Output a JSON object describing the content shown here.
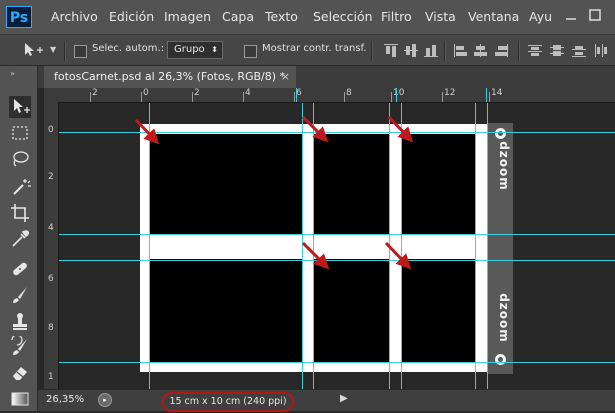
{
  "app": {
    "logo": "Ps"
  },
  "menu": [
    "Archivo",
    "Edición",
    "Imagen",
    "Capa",
    "Texto",
    "Selección",
    "Filtro",
    "Vista",
    "Ventana",
    "Ayu"
  ],
  "options": {
    "auto_select_label": "Selec. autom.:",
    "auto_select_value": "Grupo",
    "transform_label": "Mostrar contr. transf."
  },
  "tools": [
    "move-tool",
    "marquee-tool",
    "lasso-tool",
    "magic-wand-tool",
    "crop-tool",
    "eyedropper-tool",
    "healing-brush-tool",
    "brush-tool",
    "clone-stamp-tool",
    "history-brush-tool",
    "eraser-tool",
    "gradient-tool"
  ],
  "document": {
    "tab_title": "fotosCarnet.psd al 26,3% (Fotos, RGB/8) *",
    "close_glyph": "×"
  },
  "rulers": {
    "top": [
      "2",
      "0",
      "2",
      "4",
      "6",
      "8",
      "10",
      "12",
      "14"
    ],
    "left": [
      "0",
      "2",
      "4",
      "6",
      "8",
      "1"
    ]
  },
  "canvas": {
    "watermark_top": "dzoom",
    "watermark_bottom": "dzoom"
  },
  "status": {
    "zoom": "26,35%",
    "doc_info": "15 cm x 10 cm (240 ppi)",
    "arrow": "▶"
  },
  "colors": {
    "guide": "#3cd0dc",
    "arrow": "#c0191b",
    "highlight": "#b01818",
    "accent": "#31a8ff"
  }
}
